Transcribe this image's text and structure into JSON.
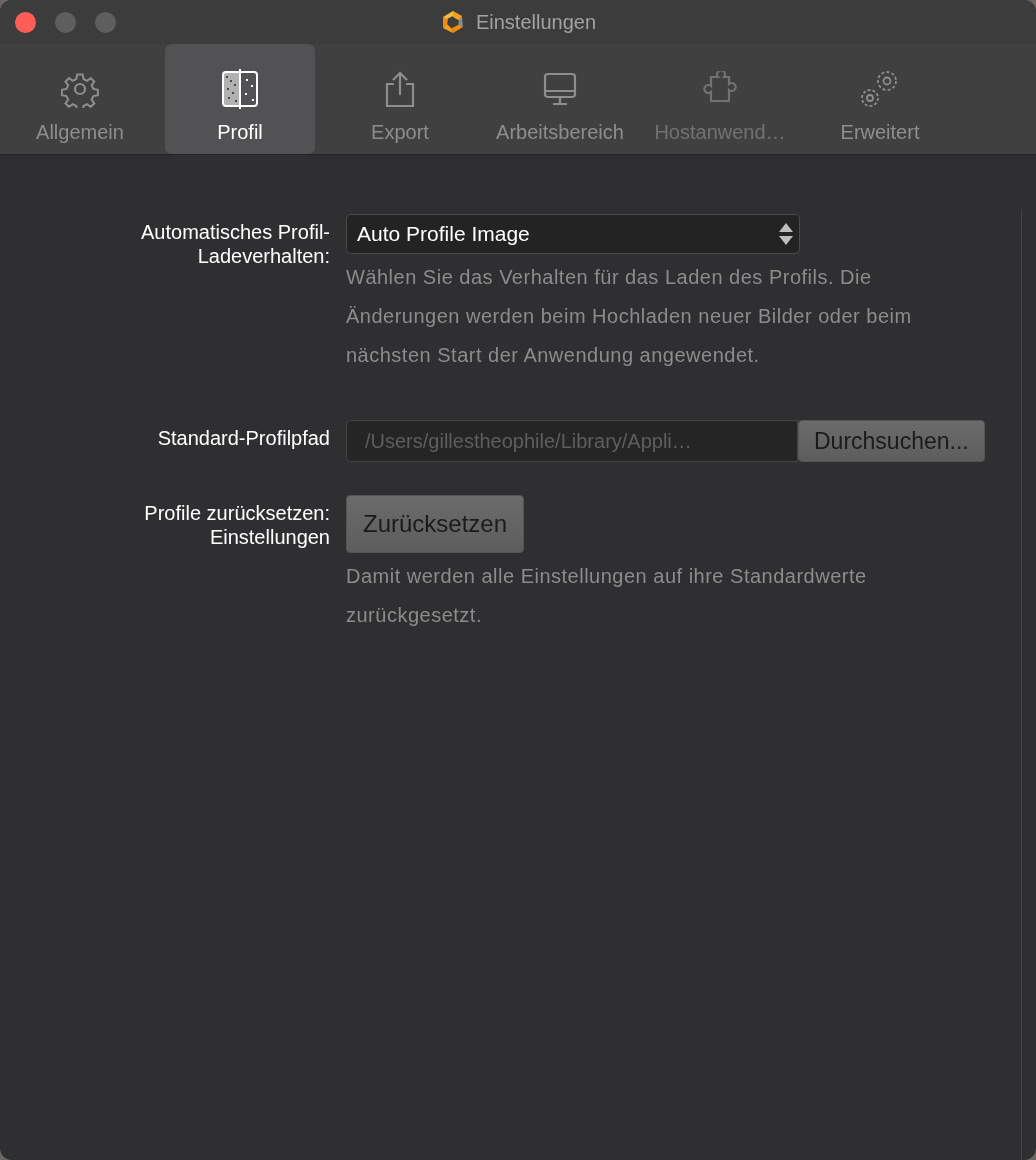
{
  "window": {
    "title": "Einstellungen"
  },
  "tabs": [
    {
      "label": "Allgemein",
      "selected": false,
      "disabled": false
    },
    {
      "label": "Profil",
      "selected": true,
      "disabled": false
    },
    {
      "label": "Export",
      "selected": false,
      "disabled": false
    },
    {
      "label": "Arbeitsbereich",
      "selected": false,
      "disabled": false
    },
    {
      "label": "Hostanwend…",
      "selected": false,
      "disabled": true
    },
    {
      "label": "Erweitert",
      "selected": false,
      "disabled": false
    }
  ],
  "settings": [
    {
      "kind": "select",
      "label": "Automatisches Profil-Ladeverhalten:",
      "value": "Auto Profile Image",
      "description": "Wählen Sie das Verhalten für das Laden des Profils. Die Änderungen werden beim Hochladen neuer Bilder oder beim nächsten Start der Anwendung angewendet."
    },
    {
      "kind": "path",
      "label": "Standard-Profilpfad",
      "value": "/Users/gillestheophile/Library/Appli…",
      "disabled": true,
      "button": "Durchsuchen..."
    },
    {
      "kind": "button",
      "label": "Profile zurücksetzen: Einstellungen",
      "button": "Zurücksetzen",
      "description": "Damit werden alle Einstellungen auf ihre Standardwerte zurückgesetzt."
    }
  ]
}
